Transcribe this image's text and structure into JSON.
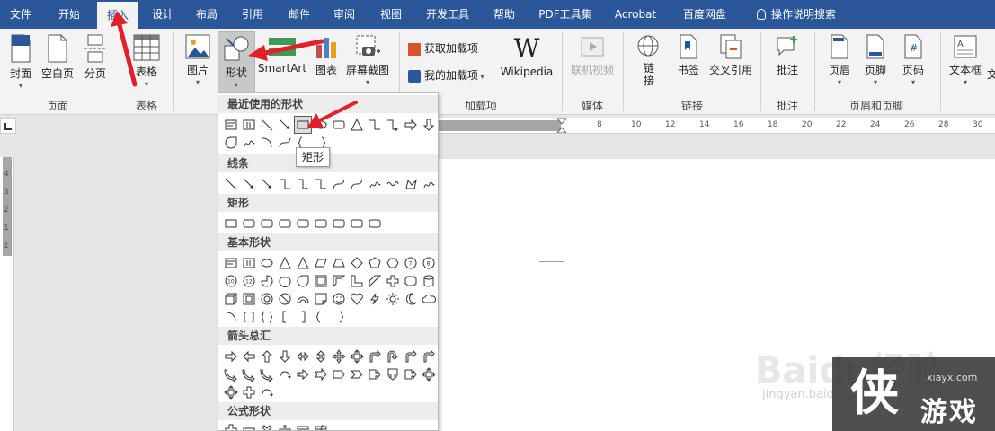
{
  "tabs": [
    {
      "label": "文件",
      "active": false
    },
    {
      "label": "开始",
      "active": false
    },
    {
      "label": "插入",
      "active": true
    },
    {
      "label": "设计",
      "active": false
    },
    {
      "label": "布局",
      "active": false
    },
    {
      "label": "引用",
      "active": false
    },
    {
      "label": "邮件",
      "active": false
    },
    {
      "label": "审阅",
      "active": false
    },
    {
      "label": "视图",
      "active": false
    },
    {
      "label": "开发工具",
      "active": false
    },
    {
      "label": "帮助",
      "active": false
    },
    {
      "label": "PDF工具集",
      "active": false
    },
    {
      "label": "Acrobat",
      "active": false
    },
    {
      "label": "百度网盘",
      "active": false
    },
    {
      "label": "操作说明搜索",
      "active": false
    }
  ],
  "ribbon": {
    "pages": {
      "cover": "封面",
      "blank": "空白页",
      "break": "分页",
      "group": "页面"
    },
    "tables": {
      "table": "表格",
      "group": "表格"
    },
    "illustrations": {
      "picture": "图片",
      "shapes": "形状",
      "smartart": "SmartArt",
      "chart": "图表",
      "screenshot": "屏幕截图"
    },
    "addins": {
      "get": "获取加载项",
      "mine": "我的加载项",
      "wikipedia": "Wikipedia",
      "group": "加载项"
    },
    "media": {
      "video": "联机视频",
      "group": "媒体"
    },
    "links": {
      "link": "链接",
      "link_line1": "链",
      "link_line2": "接",
      "bookmark": "书签",
      "crossref": "交叉引用",
      "group": "链接"
    },
    "comments": {
      "comment": "批注",
      "group": "批注"
    },
    "headerfooter": {
      "header": "页眉",
      "footer": "页脚",
      "pagenum": "页码",
      "group": "页眉和页脚"
    },
    "text": {
      "textbox": "文本框",
      "more": "文"
    }
  },
  "shapes_menu": {
    "recent": "最近使用的形状",
    "lines": "线条",
    "rectangles": "矩形",
    "basic": "基本形状",
    "arrows": "箭头总汇",
    "equation": "公式形状",
    "tooltip": "矩形"
  },
  "ruler": {
    "numbers": [
      "8",
      "10",
      "12",
      "14",
      "16",
      "18",
      "20",
      "22",
      "24",
      "26",
      "28",
      "30"
    ]
  },
  "vruler": {
    "numbers": [
      "4",
      "3",
      "2",
      "1",
      "1"
    ]
  },
  "watermark": {
    "baidu": "Baidu经验",
    "jingyan": "jingyan.baidu.com",
    "site": "xiayx.com",
    "name": "游戏",
    "logo": "侠"
  },
  "colors": {
    "accent": "#2b579a",
    "arrow": "#e0202a"
  }
}
